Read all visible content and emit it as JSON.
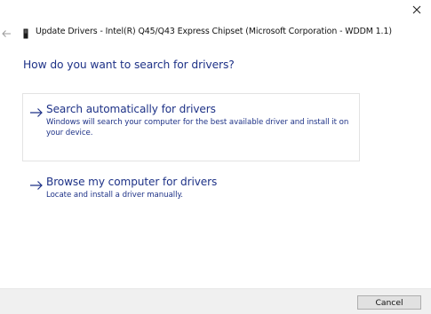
{
  "window": {
    "title": "Update Drivers - Intel(R) Q45/Q43 Express Chipset (Microsoft Corporation - WDDM 1.1)",
    "close_icon": "close-icon",
    "back_icon": "back-arrow-icon",
    "device_icon": "device-icon"
  },
  "main": {
    "heading": "How do you want to search for drivers?",
    "options": [
      {
        "icon": "arrow-right-icon",
        "title": "Search automatically for drivers",
        "description": "Windows will search your computer for the best available driver and install it on your device."
      },
      {
        "icon": "arrow-right-icon",
        "title": "Browse my computer for drivers",
        "description": "Locate and install a driver manually."
      }
    ]
  },
  "footer": {
    "cancel_label": "Cancel"
  },
  "colors": {
    "link_blue": "#1e3287",
    "footer_bg": "#f0f0f0",
    "option_border": "#e3e3e3",
    "button_bg": "#e1e1e1"
  }
}
